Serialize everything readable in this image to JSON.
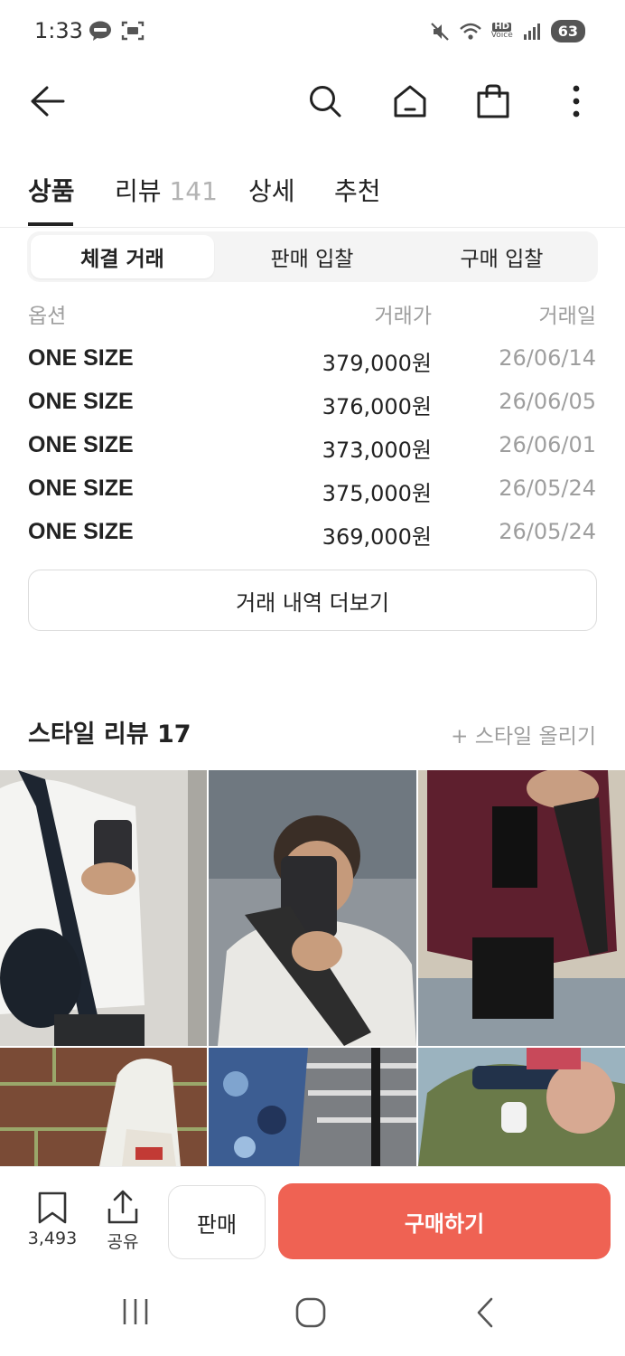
{
  "status_bar": {
    "time": "1:33",
    "battery": "63",
    "hd_label_top": "HD",
    "hd_label_bottom": "Voice"
  },
  "tabs": [
    {
      "label": "상품",
      "count": ""
    },
    {
      "label": "리뷰",
      "count": "141"
    },
    {
      "label": "상세",
      "count": ""
    },
    {
      "label": "추천",
      "count": ""
    }
  ],
  "segment": {
    "items": [
      "체결 거래",
      "판매 입찰",
      "구매 입찰"
    ],
    "active_index": 0
  },
  "trades": {
    "headers": {
      "option": "옵션",
      "price": "거래가",
      "date": "거래일"
    },
    "rows": [
      {
        "option": "ONE SIZE",
        "price": "379,000원",
        "date": "26/06/14"
      },
      {
        "option": "ONE SIZE",
        "price": "376,000원",
        "date": "26/06/05"
      },
      {
        "option": "ONE SIZE",
        "price": "373,000원",
        "date": "26/06/01"
      },
      {
        "option": "ONE SIZE",
        "price": "375,000원",
        "date": "26/05/24"
      },
      {
        "option": "ONE SIZE",
        "price": "369,000원",
        "date": "26/05/24"
      }
    ],
    "more_label": "거래 내역 더보기"
  },
  "style_review": {
    "title": "스타일 리뷰 17",
    "upload_label": "+ 스타일 올리기",
    "photos": [
      {
        "name": "style-photo-1",
        "tone": "#d9d6cf"
      },
      {
        "name": "style-photo-2",
        "tone": "#9a9ea3"
      },
      {
        "name": "style-photo-3",
        "tone": "#c9c2b4"
      },
      {
        "name": "style-photo-4",
        "tone": "#7a4a36"
      },
      {
        "name": "style-photo-5",
        "tone": "#3d5f96"
      },
      {
        "name": "style-photo-6",
        "tone": "#6c7a4c"
      }
    ]
  },
  "bottom_bar": {
    "bookmark_count": "3,493",
    "share_label": "공유",
    "sell_label": "판매",
    "buy_label": "구매하기",
    "buy_color": "#ef6253"
  }
}
